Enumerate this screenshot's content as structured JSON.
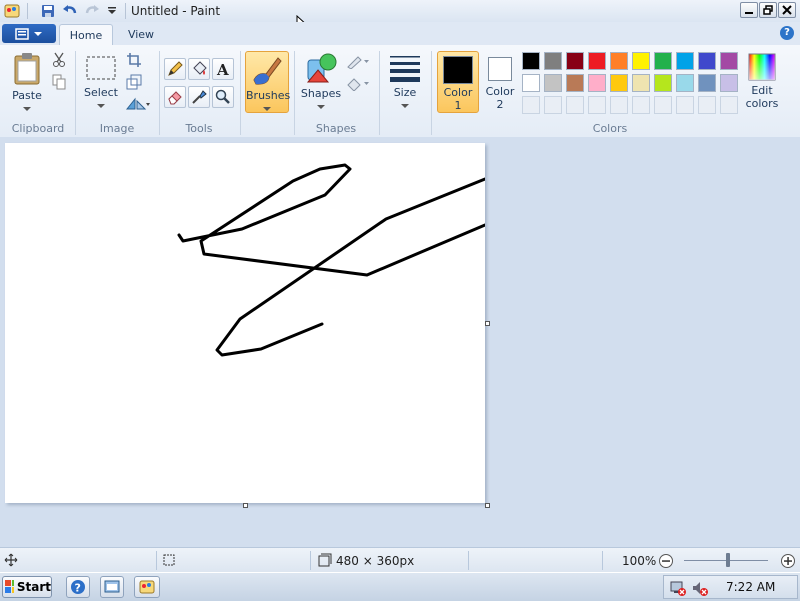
{
  "window": {
    "title": "Untitled - Paint"
  },
  "tabs": [
    {
      "label": "Home"
    },
    {
      "label": "View"
    }
  ],
  "ribbon": {
    "clipboard": {
      "paste_label": "Paste",
      "group_label": "Clipboard"
    },
    "image": {
      "select_label": "Select",
      "group_label": "Image"
    },
    "tools": {
      "group_label": "Tools"
    },
    "brushes": {
      "label": "Brushes"
    },
    "shapes": {
      "label": "Shapes",
      "group_label": "Shapes"
    },
    "size": {
      "label": "Size"
    },
    "colors": {
      "color1_label": "Color",
      "color1_num": "1",
      "color2_label": "Color",
      "color2_num": "2",
      "edit_label_1": "Edit",
      "edit_label_2": "colors",
      "group_label": "Colors",
      "color1_value": "#000000",
      "color2_value": "#ffffff",
      "palette_row1": [
        "#000000",
        "#7f7f7f",
        "#880015",
        "#ed1c24",
        "#ff7f27",
        "#fff200",
        "#22b14c",
        "#00a2e8",
        "#3f48cc",
        "#a349a4"
      ],
      "palette_row2": [
        "#ffffff",
        "#c3c3c3",
        "#b97a57",
        "#ffaec9",
        "#ffc90e",
        "#efe4b0",
        "#b5e61d",
        "#99d9ea",
        "#7092be",
        "#c8bfe7"
      ]
    }
  },
  "status": {
    "canvas_size": "480 × 360px",
    "zoom": "100%"
  },
  "taskbar": {
    "start_label": "Start",
    "clock": "7:22 AM"
  },
  "icons": {
    "cursor_icon": "arrow-cursor-icon"
  }
}
